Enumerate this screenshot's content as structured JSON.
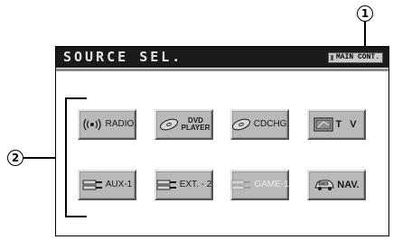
{
  "callouts": [
    "1",
    "2"
  ],
  "screen": {
    "title": "SOURCE SEL.",
    "main_cont_label": "MAIN CONT."
  },
  "sources": [
    {
      "label": "RADIO",
      "icon": "radio-waves-icon",
      "enabled": true
    },
    {
      "label_line1": "DVD",
      "label_line2": "PLAYER",
      "icon": "disc-icon",
      "enabled": true
    },
    {
      "label": "CDCHG.",
      "icon": "disc-icon",
      "enabled": true
    },
    {
      "label": "T V",
      "icon": "tv-icon",
      "enabled": true
    },
    {
      "label": "AUX-1",
      "icon": "connector-icon",
      "enabled": true
    },
    {
      "label": "EXT. - 2",
      "icon": "connector-icon",
      "enabled": true
    },
    {
      "label": "GAME-1",
      "icon": "connector-icon",
      "enabled": false
    },
    {
      "label": "NAV.",
      "icon": "navigation-car-icon",
      "enabled": true
    }
  ],
  "colors": {
    "title_bar": "#1a1a1a",
    "button_face": "#b9b9b9",
    "disabled_text": "#ededed"
  }
}
